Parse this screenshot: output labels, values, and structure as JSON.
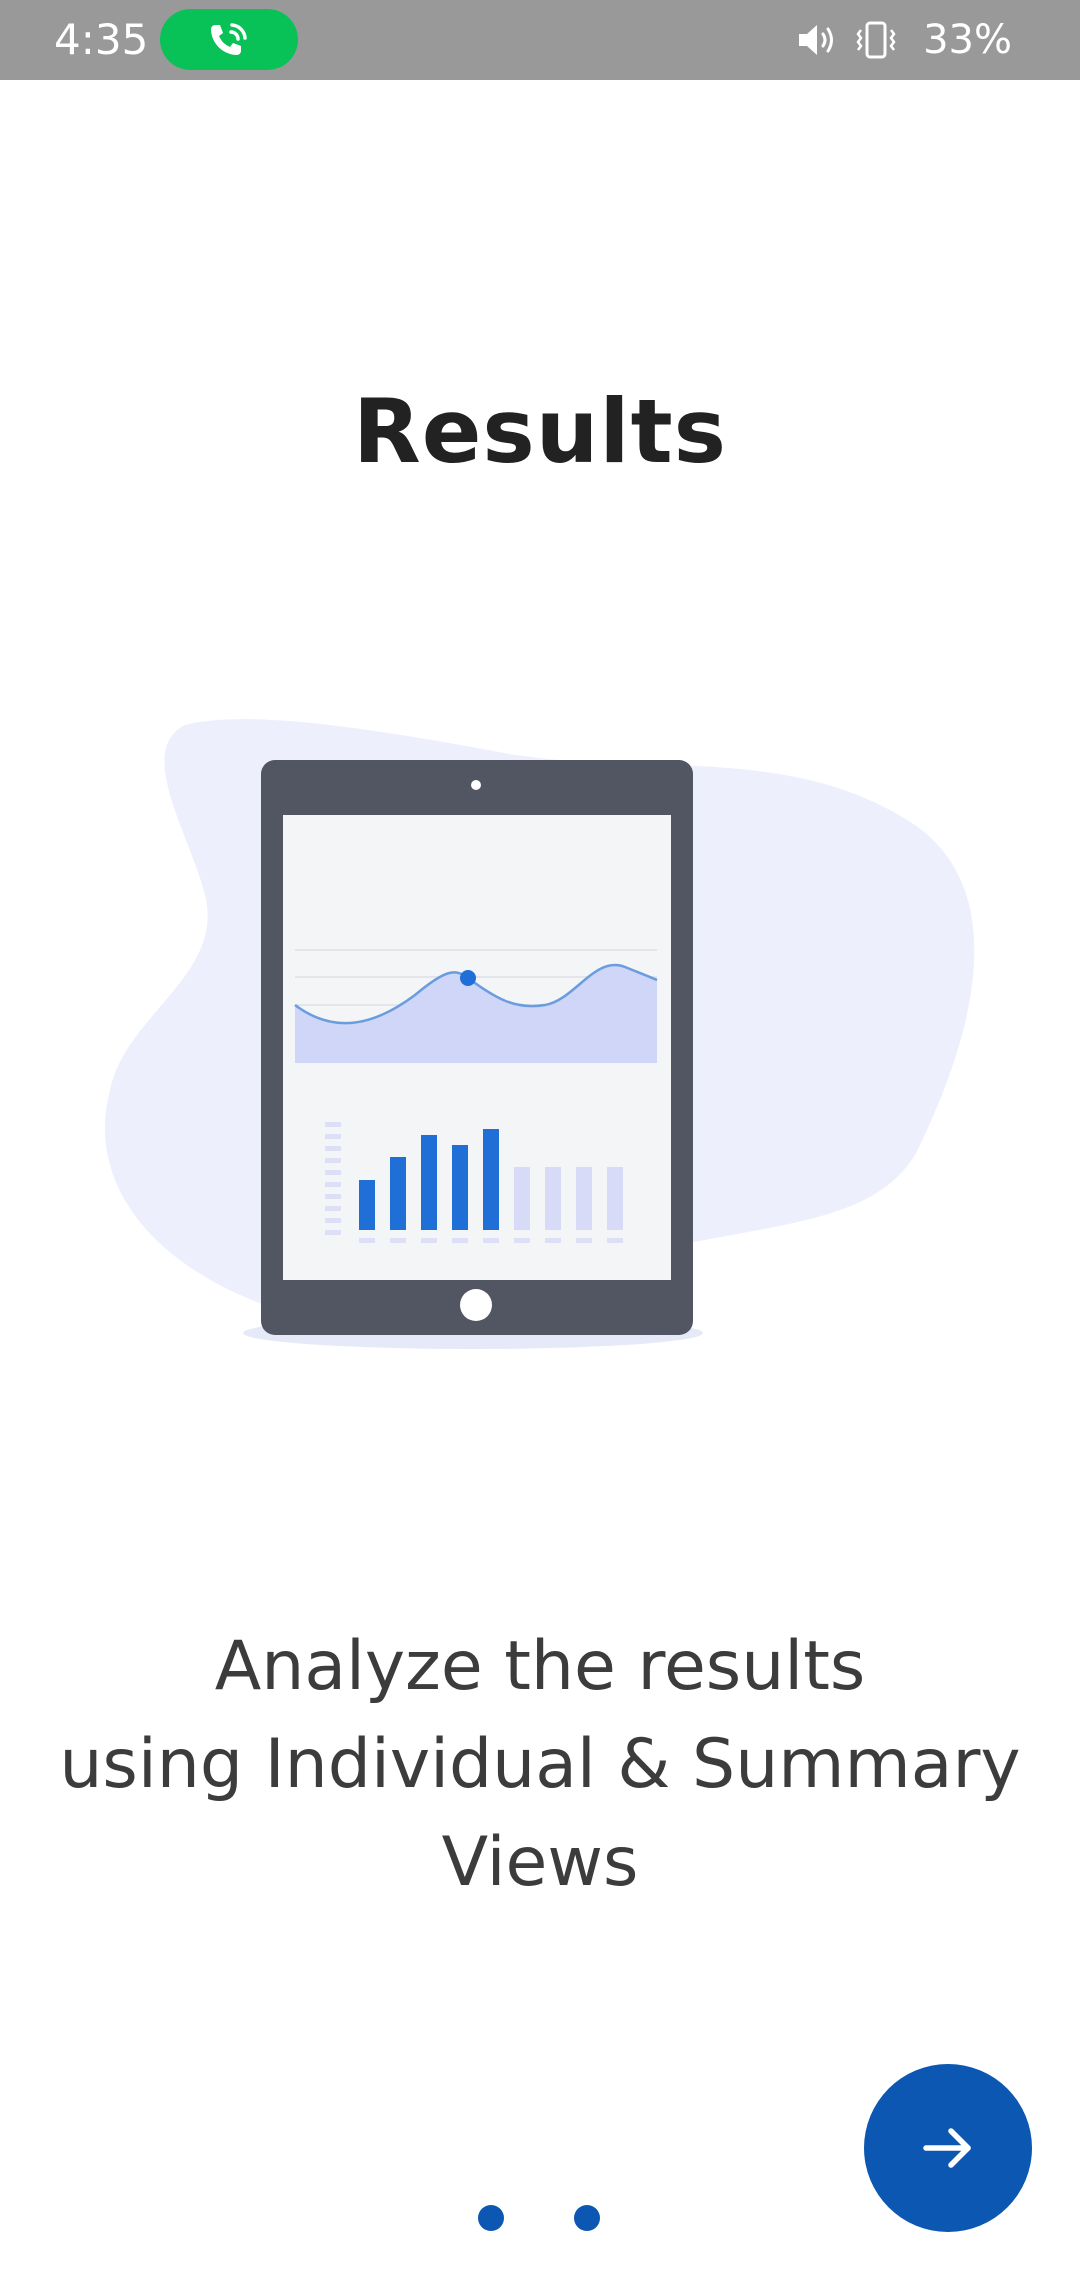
{
  "status_bar": {
    "time": "4:35",
    "battery": "33%",
    "icons": [
      "call-icon",
      "volume-icon",
      "vibrate-icon"
    ],
    "call_pill_color": "#08c257",
    "background_color": "#999999"
  },
  "onboarding": {
    "title": "Results",
    "description_lines": [
      "Analyze the results",
      "using Individual & Summary",
      "Views"
    ],
    "illustration": "tablet-chart-illustration",
    "next_icon": "arrow-right-icon",
    "accent_color": "#0b57b2",
    "page_indicator_dots": 2
  }
}
